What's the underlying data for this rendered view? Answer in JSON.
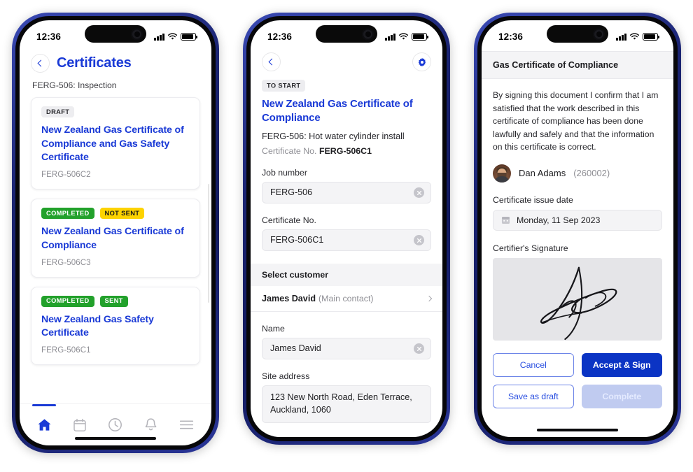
{
  "status_bar": {
    "time": "12:36",
    "signal_icon": "cellular-bars-icon",
    "wifi_icon": "wifi-icon",
    "battery_icon": "battery-icon"
  },
  "accent": {
    "blue": "#1a3ad6",
    "primary_blue": "#0b34c4",
    "green": "#22a12b",
    "yellow": "#fdd301",
    "grey_badge": "#ededf0"
  },
  "screen1": {
    "back_icon": "chevron-left-icon",
    "title": "Certificates",
    "subtitle": "FERG-506: Inspection",
    "cards": [
      {
        "badges": [
          {
            "label": "DRAFT",
            "style": "draft"
          }
        ],
        "title": "New Zealand Gas Certificate of Compliance and Gas Safety Certificate",
        "reference": "FERG-506C2"
      },
      {
        "badges": [
          {
            "label": "COMPLETED",
            "style": "completed"
          },
          {
            "label": "NOT SENT",
            "style": "notsent"
          }
        ],
        "title": "New Zealand Gas Certificate of Compliance",
        "reference": "FERG-506C3"
      },
      {
        "badges": [
          {
            "label": "COMPLETED",
            "style": "completed"
          },
          {
            "label": "SENT",
            "style": "sent"
          }
        ],
        "title": "New Zealand Gas Safety Certificate",
        "reference": "FERG-506C1"
      }
    ],
    "tabs": [
      {
        "name": "home",
        "icon": "home-icon",
        "active": true
      },
      {
        "name": "calendar",
        "icon": "calendar-icon",
        "active": false
      },
      {
        "name": "history",
        "icon": "clock-icon",
        "active": false
      },
      {
        "name": "notifications",
        "icon": "bell-icon",
        "active": false
      },
      {
        "name": "menu",
        "icon": "hamburger-menu-icon",
        "active": false
      }
    ]
  },
  "screen2": {
    "back_icon": "chevron-left-icon",
    "settings_icon": "gear-icon",
    "status_badge": "TO START",
    "cert_title": "New Zealand Gas Certificate of Compliance",
    "job_line": "FERG-506: Hot water cylinder install",
    "cert_no_label": "Certificate No.",
    "cert_no_value": "FERG-506C1",
    "fields": [
      {
        "label": "Job number",
        "value": "FERG-506",
        "clear_icon": "clear-circle-icon"
      },
      {
        "label": "Certificate No.",
        "value": "FERG-506C1",
        "clear_icon": "clear-circle-icon"
      }
    ],
    "section_header": "Select customer",
    "customer": {
      "name": "James David",
      "role": "(Main contact)",
      "chevron_icon": "chevron-right-icon"
    },
    "name_field": {
      "label": "Name",
      "value": "James David",
      "clear_icon": "clear-circle-icon"
    },
    "address_field": {
      "label": "Site address",
      "value": "123 New North Road, Eden Terrace, Auckland, 1060"
    }
  },
  "screen3": {
    "sheet_title": "Gas Certificate of Compliance",
    "declaration": "By signing this document I confirm that I am satisfied that the work described in this certificate of compliance has been done lawfully and safely and that the information on this certificate is correct.",
    "signer": {
      "avatar_icon": "user-avatar",
      "name": "Dan Adams",
      "id": "(260002)"
    },
    "issue_date": {
      "label": "Certificate issue date",
      "calendar_icon": "calendar-icon",
      "value": "Monday, 11 Sep 2023"
    },
    "signature": {
      "label": "Certifier's Signature",
      "pad_icon": "handwritten-signature"
    },
    "buttons": [
      {
        "label": "Cancel",
        "style": "outline"
      },
      {
        "label": "Accept & Sign",
        "style": "primary"
      },
      {
        "label": "Save as draft",
        "style": "outline"
      },
      {
        "label": "Complete",
        "style": "disabled"
      }
    ]
  }
}
